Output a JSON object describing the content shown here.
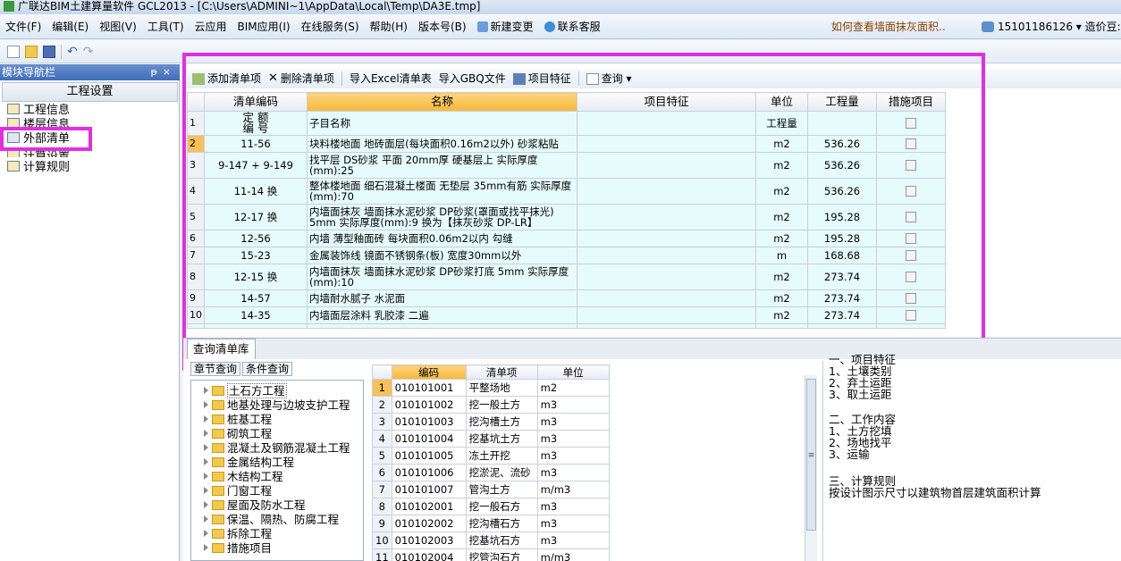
{
  "window": {
    "title": "广联达BIM土建算量软件 GCL2013 - [C:\\Users\\ADMINI~1\\AppData\\Local\\Temp\\DA3E.tmp]"
  },
  "menu": {
    "items": [
      "文件(F)",
      "编辑(E)",
      "视图(V)",
      "工具(T)",
      "云应用",
      "BIM应用(I)",
      "在线服务(S)",
      "帮助(H)",
      "版本号(B)",
      "新建变更",
      "联系客服"
    ],
    "faq": "如何查看墙面抹灰面积..",
    "user": "15101186126 ▾ 造价豆:"
  },
  "left_panel": {
    "title": "模块导航栏",
    "pin": "ᵽ",
    "close": "×",
    "section": "工程设置",
    "items": [
      "工程信息",
      "楼层信息",
      "外部清单",
      "计算设置",
      "计算规则"
    ]
  },
  "grid_toolbar": {
    "add": "添加清单项",
    "delete": "删除清单项",
    "import_excel": "导入Excel清单表",
    "import_gbq": "导入GBQ文件",
    "features": "项目特征",
    "query": "查询 ▾"
  },
  "grid": {
    "headers": [
      "",
      "清单编码",
      "名称",
      "项目特征",
      "单位",
      "工程量",
      "措施项目"
    ],
    "rows": [
      {
        "n": "1",
        "code": "定 额\n编 号",
        "name": "子目名称",
        "unit": "工程量",
        "qty": ""
      },
      {
        "n": "2",
        "code": "11-56",
        "name": "块料楼地面 地砖面层(每块面积0.16m2以外) 砂浆粘贴",
        "unit": "m2",
        "qty": "536.26"
      },
      {
        "n": "3",
        "code": "9-147 + 9-149",
        "name": "找平层 DS砂浆 平面 20mm厚 硬基层上  实际厚度(mm):25",
        "unit": "m2",
        "qty": "536.26"
      },
      {
        "n": "4",
        "code": "11-14 换",
        "name": "整体楼地面 细石混凝土楼面 无垫层 35mm有筋  实际厚度(mm):70",
        "unit": "m2",
        "qty": "536.26"
      },
      {
        "n": "5",
        "code": "12-17 换",
        "name": "内墙面抹灰 墙面抹水泥砂浆 DP砂浆(罩面或找平抹光) 5mm  实际厚度(mm):9  换为【抹灰砂浆 DP-LR】",
        "unit": "m2",
        "qty": "195.28"
      },
      {
        "n": "6",
        "code": "12-56",
        "name": "内墙 薄型釉面砖 每块面积0.06m2以内 勾缝",
        "unit": "m2",
        "qty": "195.28"
      },
      {
        "n": "7",
        "code": "15-23",
        "name": "金属装饰线 镜面不锈钢条(板) 宽度30mm以外",
        "unit": "m",
        "qty": "168.68"
      },
      {
        "n": "8",
        "code": "12-15 换",
        "name": "内墙面抹灰 墙面抹水泥砂浆 DP砂浆打底 5mm  实际厚度(mm):10",
        "unit": "m2",
        "qty": "273.74"
      },
      {
        "n": "9",
        "code": "14-57",
        "name": "内墙耐水腻子 水泥面",
        "unit": "m2",
        "qty": "273.74"
      },
      {
        "n": "10",
        "code": "14-35",
        "name": "内墙面层涂料 乳胶漆 二遍",
        "unit": "m2",
        "qty": "273.74"
      }
    ]
  },
  "bottom": {
    "tab": "查询清单库",
    "subtabs": [
      "章节查询",
      "条件查询"
    ],
    "tree": [
      "土石方工程",
      "地基处理与边坡支护工程",
      "桩基工程",
      "砌筑工程",
      "混凝土及钢筋混凝土工程",
      "金属结构工程",
      "木结构工程",
      "门窗工程",
      "屋面及防水工程",
      "保温、隔热、防腐工程",
      "拆除工程",
      "措施项目"
    ],
    "lib_headers": [
      "",
      "编码",
      "清单项",
      "单位"
    ],
    "lib_rows": [
      [
        "1",
        "010101001",
        "平整场地",
        "m2"
      ],
      [
        "2",
        "010101002",
        "挖一般土方",
        "m3"
      ],
      [
        "3",
        "010101003",
        "挖沟槽土方",
        "m3"
      ],
      [
        "4",
        "010101004",
        "挖基坑土方",
        "m3"
      ],
      [
        "5",
        "010101005",
        "冻土开挖",
        "m3"
      ],
      [
        "6",
        "010101006",
        "挖淤泥、流砂",
        "m3"
      ],
      [
        "7",
        "010101007",
        "管沟土方",
        "m/m3"
      ],
      [
        "8",
        "010102001",
        "挖一般石方",
        "m3"
      ],
      [
        "9",
        "010102002",
        "挖沟槽石方",
        "m3"
      ],
      [
        "10",
        "010102003",
        "挖基坑石方",
        "m3"
      ],
      [
        "11",
        "010102004",
        "挖管沟石方",
        "m/m3"
      ]
    ],
    "desc_lines": [
      "一、项目特征",
      "1、土壤类别",
      "2、弃土运距",
      "3、取土运距",
      "",
      "二、工作内容",
      "1、土方挖填",
      "2、场地找平",
      "3、运输",
      "",
      "三、计算规则",
      "  按设计图示尺寸以建筑物首层建筑面积计算"
    ]
  },
  "colors": {
    "highlight": "#e12ee3",
    "selected_row": "#f7c058",
    "grid_cell": "#e6fbfb"
  }
}
